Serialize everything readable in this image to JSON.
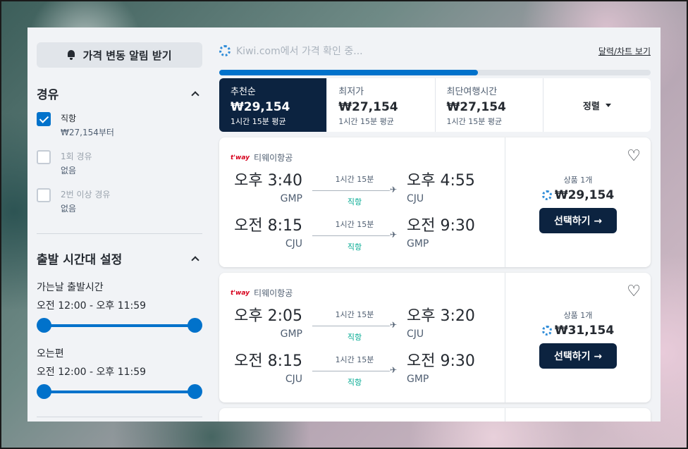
{
  "sidebar": {
    "alert_button": "가격 변동 알림 받기",
    "stops": {
      "title": "경유",
      "options": [
        {
          "label": "직항",
          "sub": "₩27,154부터",
          "checked": true
        },
        {
          "label": "1회 경유",
          "sub": "없음",
          "checked": false
        },
        {
          "label": "2번 이상 경유",
          "sub": "없음",
          "checked": false
        }
      ]
    },
    "times": {
      "title": "출발 시간대 설정",
      "outbound": {
        "label": "가는날 출발시간",
        "range": "오전 12:00 - 오후 11:59"
      },
      "return": {
        "label": "오는편",
        "range": "오전 12:00 - 오후 11:59"
      }
    }
  },
  "main": {
    "loading_text": "Kiwi.com에서 가격 확인 중...",
    "calendar_link": "달력/차트 보기",
    "progress_fraction": 0.6,
    "tabs": [
      {
        "name": "추천순",
        "price": "₩29,154",
        "duration": "1시간 15분 평균"
      },
      {
        "name": "최저가",
        "price": "₩27,154",
        "duration": "1시간 15분 평균"
      },
      {
        "name": "최단여행시간",
        "price": "₩27,154",
        "duration": "1시간 15분 평균"
      }
    ],
    "sort_label": "정렬",
    "results": [
      {
        "airline_logo": "t'way",
        "airline": "티웨이항공",
        "legs": [
          {
            "dep_time": "오후 3:40",
            "dep_code": "GMP",
            "duration": "1시간 15분",
            "stops": "직항",
            "arr_time": "오후 4:55",
            "arr_code": "CJU"
          },
          {
            "dep_time": "오전 8:15",
            "dep_code": "CJU",
            "duration": "1시간 15분",
            "stops": "직항",
            "arr_time": "오전 9:30",
            "arr_code": "GMP"
          }
        ],
        "bundle": "상품 1개",
        "price": "₩29,154",
        "select": "선택하기 →"
      },
      {
        "airline_logo": "t'way",
        "airline": "티웨이항공",
        "legs": [
          {
            "dep_time": "오후 2:05",
            "dep_code": "GMP",
            "duration": "1시간 15분",
            "stops": "직항",
            "arr_time": "오후 3:20",
            "arr_code": "CJU"
          },
          {
            "dep_time": "오전 8:15",
            "dep_code": "CJU",
            "duration": "1시간 15분",
            "stops": "직항",
            "arr_time": "오전 9:30",
            "arr_code": "GMP"
          }
        ],
        "bundle": "상품 1개",
        "price": "₩31,154",
        "select": "선택하기 →"
      }
    ]
  },
  "icons": {
    "bell": "bell-icon",
    "chevron": "chevron-up-icon",
    "heart": "heart-icon",
    "plane": "airplane-icon",
    "spinner": "loading-spinner-icon"
  },
  "colors": {
    "accent": "#0172cb",
    "navy": "#0c2340",
    "direct": "#00a991",
    "airline": "#d6001c"
  }
}
